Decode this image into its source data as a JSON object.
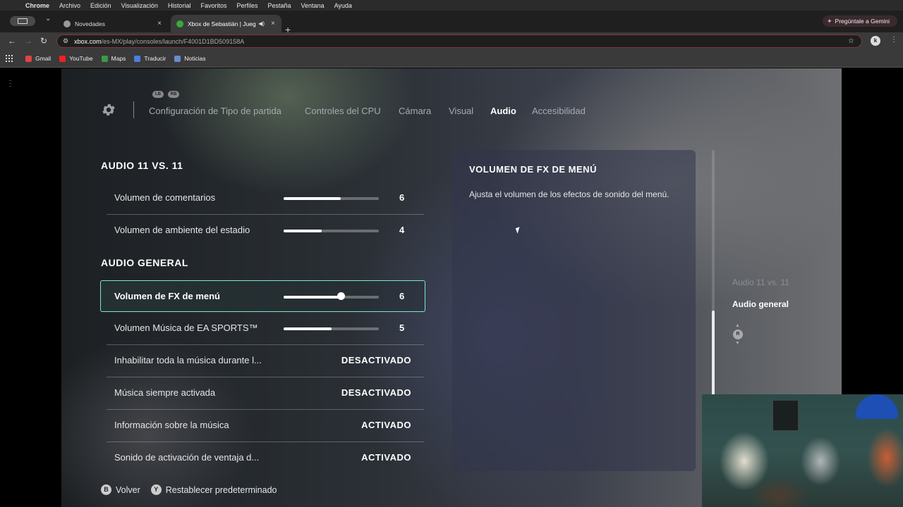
{
  "menubar": {
    "app": "Chrome",
    "items": [
      "Archivo",
      "Edición",
      "Visualización",
      "Historial",
      "Favoritos",
      "Perfiles",
      "Pestaña",
      "Ventana",
      "Ayuda"
    ]
  },
  "tabs": [
    {
      "title": "Novedades",
      "close": "×"
    },
    {
      "title": "Xbox de Sebastián | Jueg",
      "close": "×"
    }
  ],
  "newtab": "+",
  "gemini": "Pregúntale a Gemini",
  "address": {
    "host": "xbox.com",
    "path": "/es-MX/play/consoles/launch/F4001D1BD509158A"
  },
  "profile_initial": "k",
  "bookmarks": [
    "Gmail",
    "YouTube",
    "Maps",
    "Traducir",
    "Noticias"
  ],
  "game": {
    "bumpers": {
      "left": "LB",
      "right": "RB"
    },
    "tabs": [
      "Configuración de Tipo de partida",
      "Controles del CPU",
      "Cámara",
      "Visual",
      "Audio",
      "Accesibilidad"
    ],
    "active_tab": "Audio",
    "sections": {
      "s1": "AUDIO 11 VS. 11",
      "s2": "AUDIO GENERAL"
    },
    "rows": [
      {
        "label": "Volumen de comentarios",
        "value": "6",
        "level": 0.6
      },
      {
        "label": "Volumen de ambiente del estadio",
        "value": "4",
        "level": 0.4
      },
      {
        "label": "Volumen de FX de menú",
        "value": "6",
        "level": 0.6
      },
      {
        "label": "Volumen Música de EA SPORTS™",
        "value": "5",
        "level": 0.5
      },
      {
        "label": "Inhabilitar toda la música durante l...",
        "value": "DESACTIVADO"
      },
      {
        "label": "Música siempre activada",
        "value": "DESACTIVADO"
      },
      {
        "label": "Información sobre la música",
        "value": "ACTIVADO"
      },
      {
        "label": "Sonido de activación de ventaja d...",
        "value": "ACTIVADO"
      }
    ],
    "description": {
      "title": "VOLUMEN DE FX DE MENÚ",
      "body": "Ajusta el volumen de los efectos de sonido del menú."
    },
    "jump": {
      "prev": "Audio 11 vs. 11",
      "current": "Audio general",
      "stick": "R"
    },
    "footer": {
      "back_key": "B",
      "back_label": "Volver",
      "reset_key": "Y",
      "reset_label": "Restablecer predeterminado"
    }
  },
  "colors": {
    "selection_outline": "#7fe3d6",
    "omnibox_border": "#7a3a3e"
  }
}
